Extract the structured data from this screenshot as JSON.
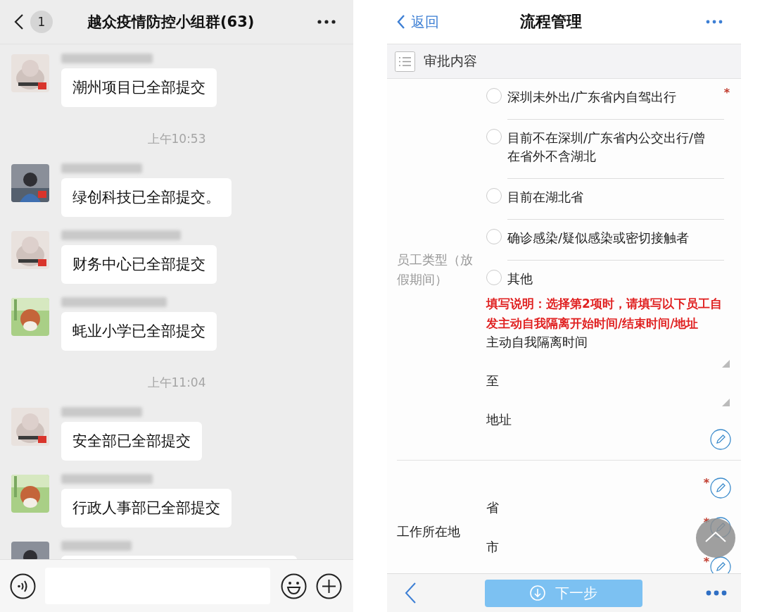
{
  "chat": {
    "unread": "1",
    "title": "越众疫情防控小组群(63)",
    "items": [
      {
        "kind": "message",
        "text": "潮州项目已全部提交"
      },
      {
        "kind": "time",
        "text": "上午10:53"
      },
      {
        "kind": "message",
        "text": "绿创科技已全部提交。"
      },
      {
        "kind": "message",
        "text": "财务中心已全部提交"
      },
      {
        "kind": "message",
        "text": "蚝业小学已全部提交"
      },
      {
        "kind": "time",
        "text": "上午11:04"
      },
      {
        "kind": "message",
        "text": "安全部已全部提交"
      },
      {
        "kind": "message",
        "text": "行政人事部已全部提交"
      },
      {
        "kind": "cut"
      }
    ]
  },
  "form": {
    "back": "返回",
    "title": "流程管理",
    "section": "审批内容",
    "groups": [
      {
        "label": "员工类型（放假期间）",
        "mark": "*",
        "options": [
          {
            "label": "深圳未外出/广东省内自驾出行",
            "selected": false
          },
          {
            "label": "目前不在深圳/广东省内公交出行/曾在省外不含湖北",
            "selected": false
          },
          {
            "label": "目前在湖北省",
            "selected": false
          },
          {
            "label": "确诊感染/疑似感染或密切接触者",
            "selected": false
          },
          {
            "label": "其他",
            "selected": false
          }
        ],
        "note": "填写说明：选择第2项时，请填写以下员工自发主动自我隔离开始时间/结束时间/地址",
        "fields": [
          {
            "kind": "textarea",
            "label": "主动自我隔离时间"
          },
          {
            "kind": "textarea",
            "label": "至"
          },
          {
            "kind": "edit",
            "label": "地址"
          }
        ]
      },
      {
        "label": "工作所在地",
        "fields": [
          {
            "kind": "edit_above",
            "label": "省",
            "mark": "*"
          },
          {
            "kind": "edit_above",
            "label": "市",
            "mark": "*"
          },
          {
            "kind": "edit_above",
            "mark": "*"
          }
        ]
      }
    ],
    "next": "下一步"
  }
}
